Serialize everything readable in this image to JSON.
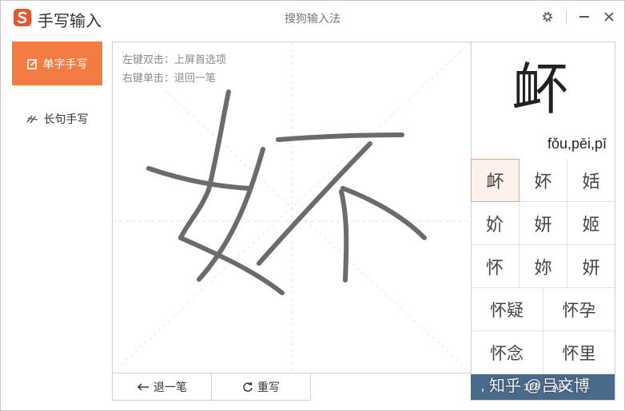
{
  "titlebar": {
    "app_name": "手写输入",
    "window_title": "搜狗输入法",
    "settings_icon": "gear-icon",
    "minimize_icon": "minimize-icon",
    "close_icon": "close-icon"
  },
  "sidebar": {
    "items": [
      {
        "label": "单字手写",
        "icon": "single-char-icon",
        "active": true
      },
      {
        "label": "长句手写",
        "icon": "sentence-icon",
        "active": false
      }
    ]
  },
  "canvas": {
    "hints": [
      "左键双击：上屏首选项",
      "右键单击：退回一笔"
    ]
  },
  "bottom_buttons": {
    "undo_label": "退一笔",
    "rewrite_label": "重写"
  },
  "candidates": {
    "preview_char": "衃",
    "pinyin": "fǒu,pēi,pī",
    "grid": [
      "衃",
      "妚",
      "姡",
      "妎",
      "妍",
      "姬",
      "怀",
      "妳",
      "妍"
    ],
    "words": [
      "怀疑",
      "怀孕",
      "怀念",
      "怀里"
    ]
  },
  "panel_bottom": {
    "punct": "，",
    "digits": "123",
    "letters": "ABC"
  },
  "watermark": "知乎 @吕文博",
  "colors": {
    "accent": "#f57c41",
    "stroke": "#6b6b6b",
    "panel_bottom": "#4a6a8a"
  }
}
